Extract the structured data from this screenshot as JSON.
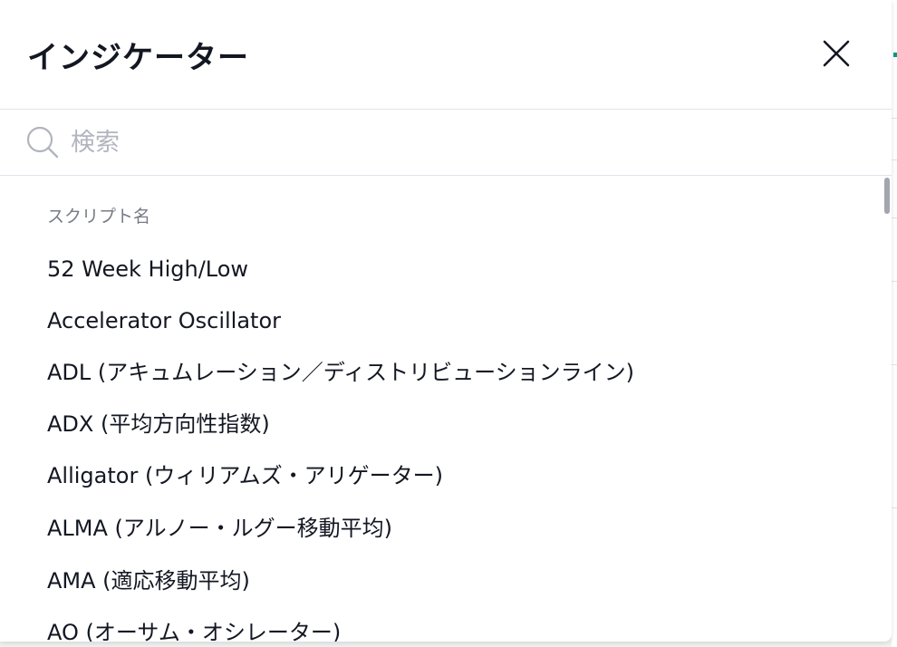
{
  "dialog": {
    "title": "インジケーター"
  },
  "icons": {
    "close": "close-icon",
    "search": "search-icon"
  },
  "search": {
    "placeholder": "検索",
    "value": ""
  },
  "list": {
    "section_label": "スクリプト名",
    "items": [
      "52 Week High/Low",
      "Accelerator Oscillator",
      "ADL (アキュムレーション／ディストリビューションライン)",
      "ADX (平均方向性指数)",
      "Alligator (ウィリアムズ・アリゲーター)",
      "ALMA (アルノー・ルグー移動平均)",
      "AMA (適応移動平均)",
      "AO (オーサム・オシレーター)"
    ]
  },
  "colors": {
    "text_primary": "#131722",
    "text_secondary": "#787b86",
    "placeholder": "#b2b5be",
    "divider": "#e0e3eb",
    "accent": "#089981"
  }
}
